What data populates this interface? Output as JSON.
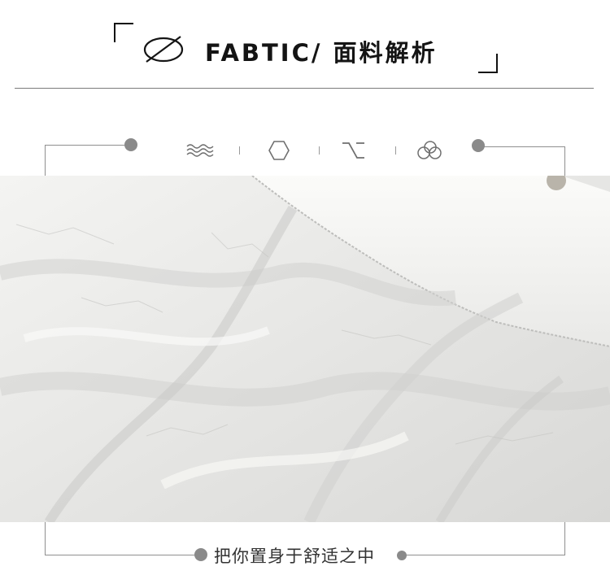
{
  "header": {
    "title": "FABTIC/ 面料解析",
    "symbol_icon": "fabric-symbol-icon"
  },
  "feature_icons": [
    "wave-icon",
    "hexagon-icon",
    "option-key-icon",
    "cloud-icon"
  ],
  "photo": {
    "subject": "fabric-photo",
    "colors": {
      "base": "#ececea",
      "shadow": "#c8c8c6",
      "highlight": "#fafaf8"
    }
  },
  "caption": "把你置身于舒适之中",
  "colors": {
    "frame": "#8f8f8f",
    "dot": "#8a8a8a",
    "text": "#141414"
  }
}
